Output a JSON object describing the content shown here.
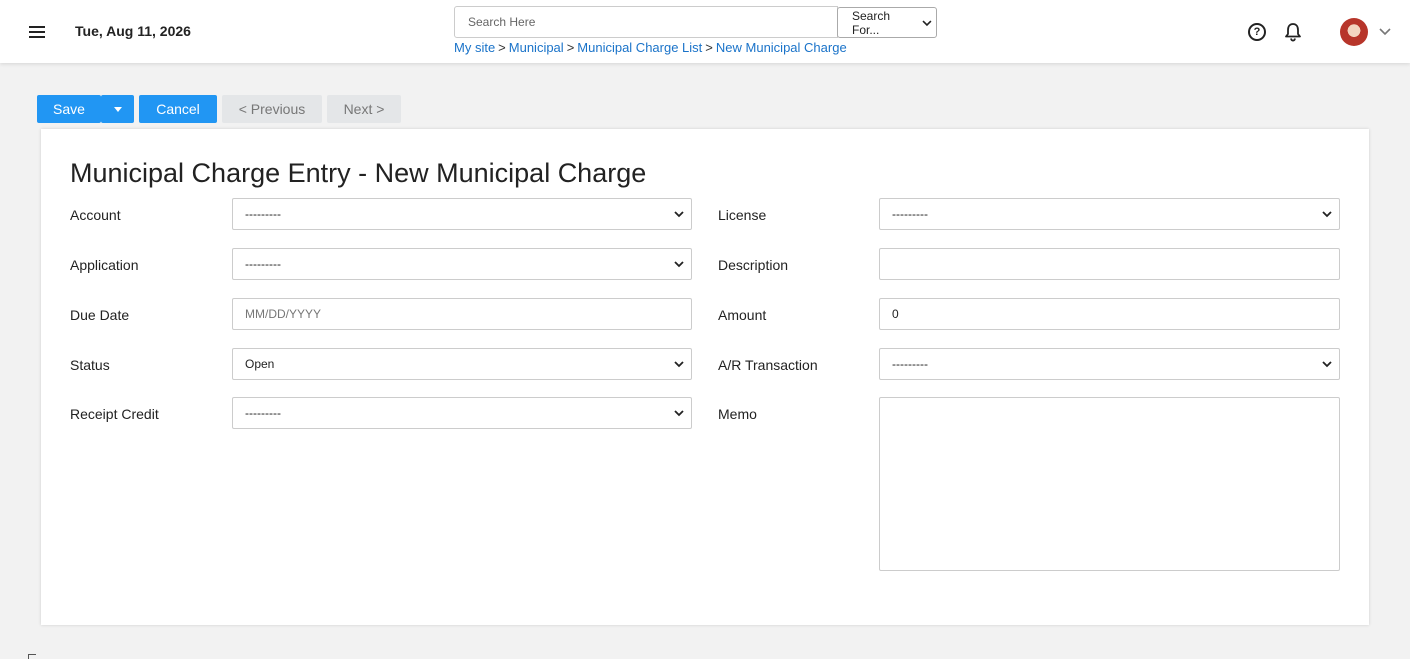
{
  "header": {
    "date": "Tue, Aug 11, 2026",
    "search_placeholder": "Search Here",
    "search_for_label": "Search For...",
    "breadcrumb": [
      "My site",
      "Municipal",
      "Municipal Charge List",
      "New Municipal Charge"
    ]
  },
  "toolbar": {
    "save_label": "Save",
    "cancel_label": "Cancel",
    "previous_label": "< Previous",
    "next_label": "Next >"
  },
  "form": {
    "title": "Municipal Charge Entry - New Municipal Charge",
    "account": {
      "label": "Account",
      "value": "---------"
    },
    "application": {
      "label": "Application",
      "value": "---------"
    },
    "due_date": {
      "label": "Due Date",
      "placeholder": "MM/DD/YYYY"
    },
    "status": {
      "label": "Status",
      "value": "Open"
    },
    "receipt_credit": {
      "label": "Receipt Credit",
      "value": "---------"
    },
    "license": {
      "label": "License",
      "value": "---------"
    },
    "description": {
      "label": "Description",
      "value": ""
    },
    "amount": {
      "label": "Amount",
      "value": "0"
    },
    "ar_transaction": {
      "label": "A/R Transaction",
      "value": "---------"
    },
    "memo": {
      "label": "Memo",
      "value": ""
    }
  },
  "colors": {
    "primary": "#2196f3",
    "link": "#1a73c9",
    "disabled_bg": "#e4e6e8"
  }
}
